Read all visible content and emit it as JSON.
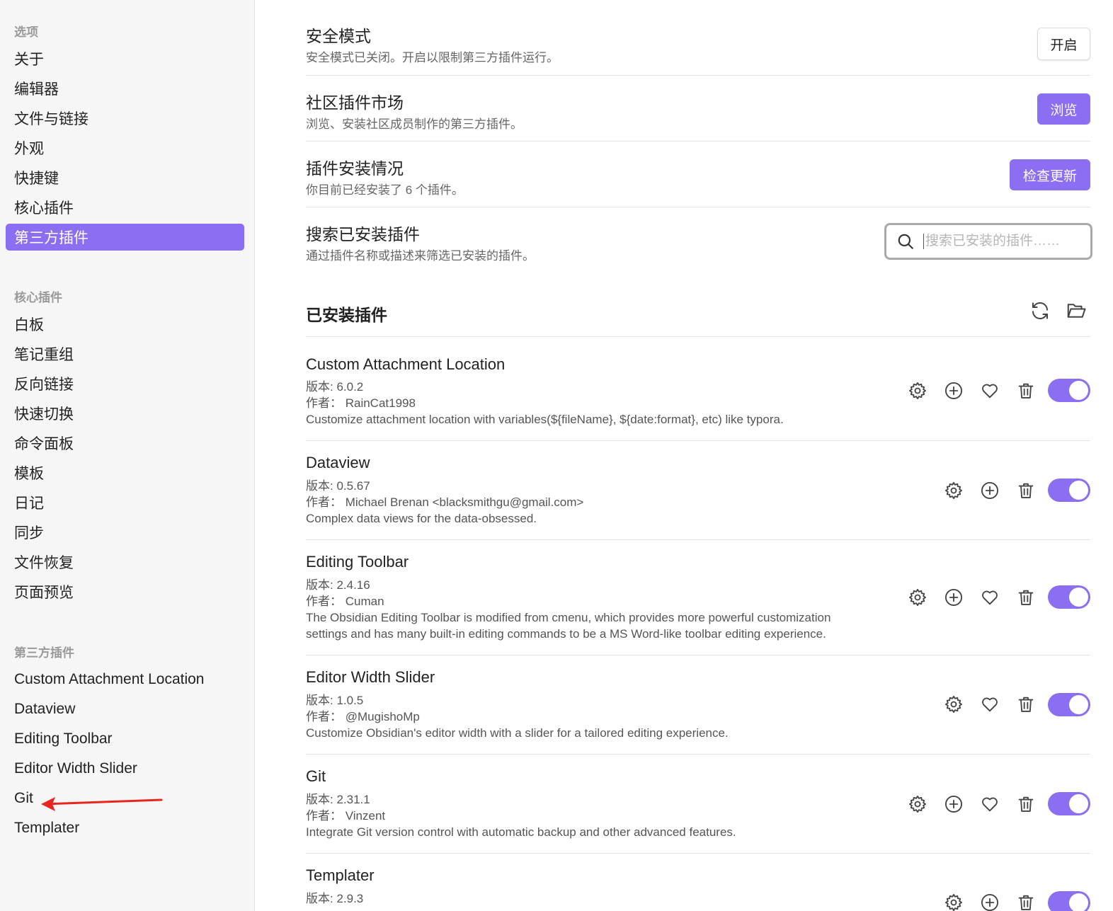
{
  "sidebar": {
    "options_heading": "选项",
    "options": [
      "关于",
      "编辑器",
      "文件与链接",
      "外观",
      "快捷键",
      "核心插件",
      "第三方插件"
    ],
    "active_option": "第三方插件",
    "core_heading": "核心插件",
    "core_plugins": [
      "白板",
      "笔记重组",
      "反向链接",
      "快速切换",
      "命令面板",
      "模板",
      "日记",
      "同步",
      "文件恢复",
      "页面预览"
    ],
    "community_heading": "第三方插件",
    "community_plugins": [
      "Custom Attachment Location",
      "Dataview",
      "Editing Toolbar",
      "Editor Width Slider",
      "Git",
      "Templater"
    ]
  },
  "settings": {
    "safe_mode": {
      "title": "安全模式",
      "desc": "安全模式已关闭。开启以限制第三方插件运行。",
      "button": "开启"
    },
    "market": {
      "title": "社区插件市场",
      "desc": "浏览、安装社区成员制作的第三方插件。",
      "button": "浏览"
    },
    "status": {
      "title": "插件安装情况",
      "desc": "你目前已经安装了 6 个插件。",
      "button": "检查更新"
    },
    "search": {
      "title": "搜索已安装插件",
      "desc": "通过插件名称或描述来筛选已安装的插件。",
      "placeholder": "搜索已安装的插件……",
      "value": ""
    }
  },
  "installed": {
    "title": "已安装插件",
    "plugins": [
      {
        "name": "Custom Attachment Location",
        "version": "版本: 6.0.2",
        "author": "作者：  RainCat1998",
        "desc": "Customize attachment location with variables(${fileName}, ${date:format}, etc) like typora.",
        "enabled": true
      },
      {
        "name": "Dataview",
        "version": "版本: 0.5.67",
        "author": "作者：  Michael Brenan <blacksmithgu@gmail.com>",
        "desc": "Complex data views for the data-obsessed.",
        "enabled": true
      },
      {
        "name": "Editing Toolbar",
        "version": "版本: 2.4.16",
        "author": "作者：  Cuman",
        "desc": "The Obsidian Editing Toolbar is modified from cmenu, which provides more powerful customization settings and has many built-in editing commands to be a MS Word-like toolbar editing experience.",
        "enabled": true
      },
      {
        "name": "Editor Width Slider",
        "version": "版本: 1.0.5",
        "author": "作者：  @MugishoMp",
        "desc": "Customize Obsidian's editor width with a slider for a tailored editing experience.",
        "enabled": true
      },
      {
        "name": "Git",
        "version": "版本: 2.31.1",
        "author": "作者：  Vinzent",
        "desc": "Integrate Git version control with automatic backup and other advanced features.",
        "enabled": true
      },
      {
        "name": "Templater",
        "version": "版本: 2.9.3",
        "author": "",
        "desc": "",
        "enabled": true
      }
    ]
  },
  "colors": {
    "accent": "#8b6ef2",
    "annotation_arrow": "#e8261f"
  },
  "icons": [
    "search-icon",
    "reload-icon",
    "folder-open-icon",
    "gear-icon",
    "plus-circle-icon",
    "heart-icon",
    "trash-icon"
  ]
}
